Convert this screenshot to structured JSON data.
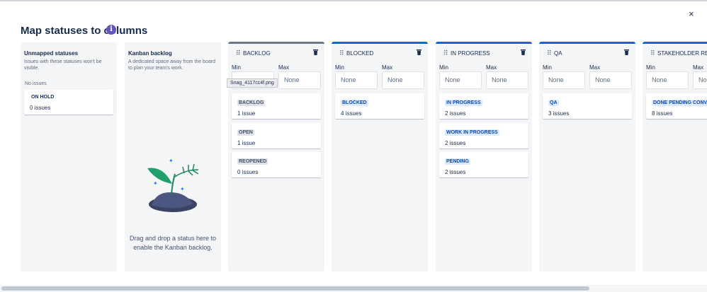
{
  "header": {
    "title": "Map statuses to columns",
    "info_icon": "info-icon",
    "close_label": "×"
  },
  "unmapped": {
    "title": "Unmapped statuses",
    "description": "Issues with these statuses won't be visible.",
    "no_issues": "No issues",
    "cards": [
      {
        "status": "ON HOLD",
        "count": "0 issues"
      }
    ]
  },
  "kanban_backlog": {
    "title": "Kanban backlog",
    "description": "A dedicated space away from the board to plan your team's work.",
    "drop_text": "Drag and drop a status here to enable the Kanban backlog."
  },
  "tooltip": "Snag_4117cc4f.png",
  "min_label": "Min",
  "max_label": "Max",
  "placeholder": "None",
  "colors": {
    "accent": "#0c66e4",
    "info": "#6554c0",
    "panel": "#f4f5f7"
  },
  "columns": [
    {
      "title": "BACKLOG",
      "bar": "gray",
      "cards": [
        {
          "status": "BACKLOG",
          "count": "1 issue",
          "style": "gray"
        },
        {
          "status": "OPEN",
          "count": "1 issue",
          "style": "gray"
        },
        {
          "status": "REOPENED",
          "count": "0 issues",
          "style": "gray"
        }
      ]
    },
    {
      "title": "BLOCKED",
      "bar": "blue",
      "cards": [
        {
          "status": "BLOCKED",
          "count": "4 issues",
          "style": "blue"
        }
      ]
    },
    {
      "title": "IN PROGRESS",
      "bar": "blue",
      "cards": [
        {
          "status": "IN PROGRESS",
          "count": "2 issues",
          "style": "blue"
        },
        {
          "status": "WORK IN PROGRESS",
          "count": "2 issues",
          "style": "blue"
        },
        {
          "status": "PENDING",
          "count": "2 issues",
          "style": "blue"
        }
      ]
    },
    {
      "title": "QA",
      "bar": "blue",
      "cards": [
        {
          "status": "QA",
          "count": "3 issues",
          "style": "blue"
        }
      ]
    },
    {
      "title": "STAKEHOLDER REVI",
      "bar": "blue",
      "cards": [
        {
          "status": "DONE PENDING CONVE",
          "count": "8 issues",
          "style": "blue"
        }
      ]
    }
  ]
}
